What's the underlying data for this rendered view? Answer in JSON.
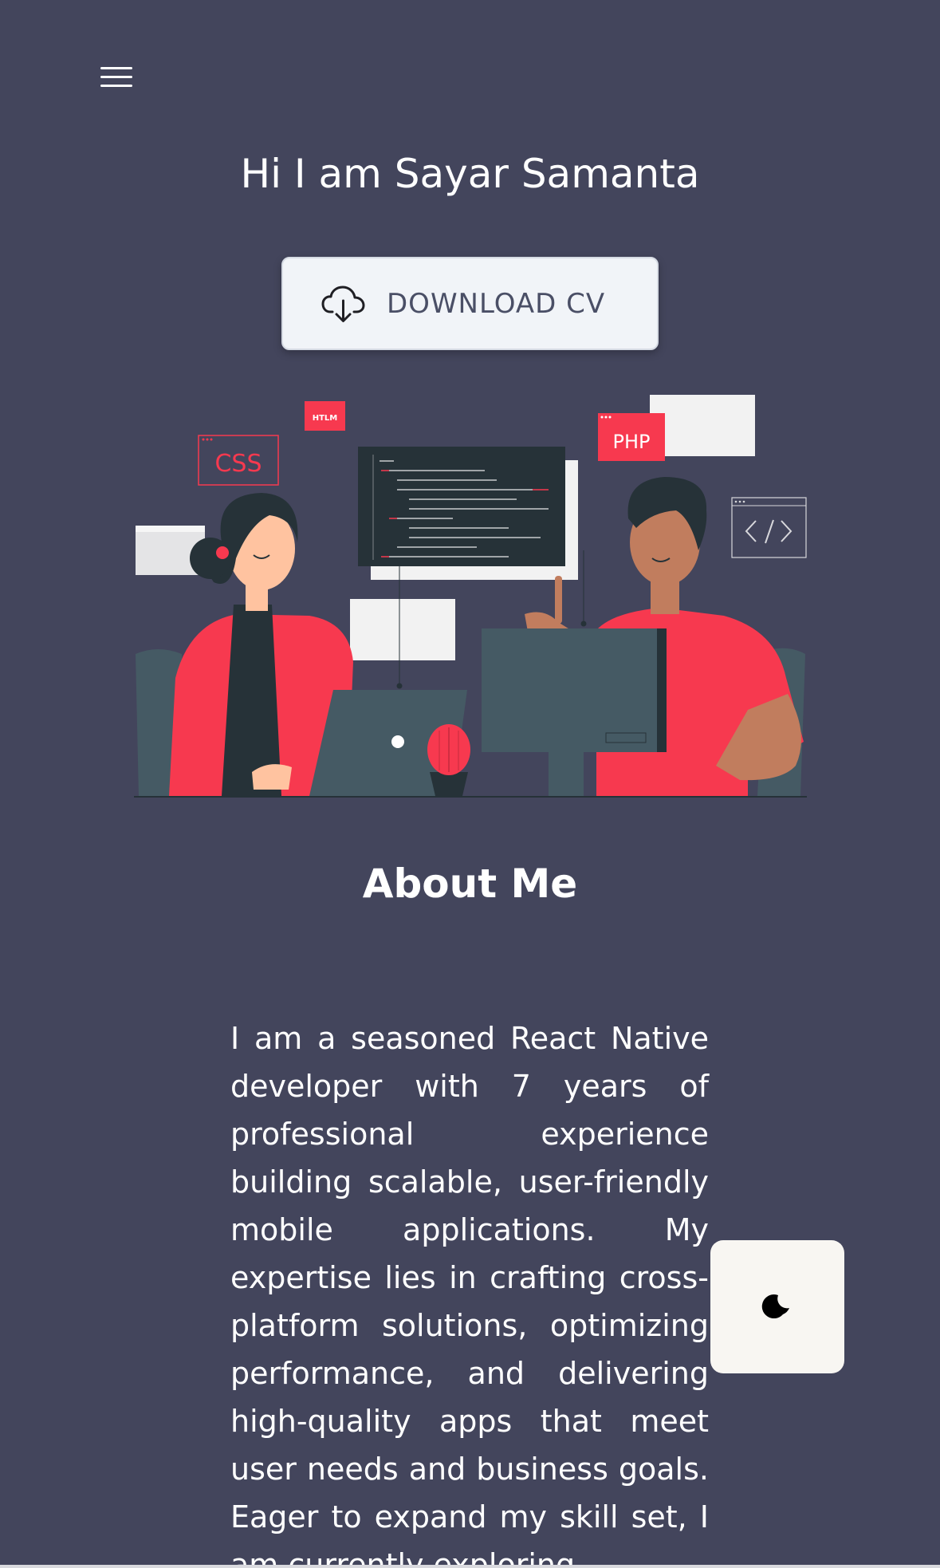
{
  "header": {
    "menu_icon": "hamburger-menu-icon"
  },
  "hero": {
    "title": "Hi I am Sayar Samanta",
    "download_button": {
      "label": "DOWNLOAD CV",
      "icon": "cloud-download-icon"
    }
  },
  "illustration": {
    "labels": {
      "css": "CSS",
      "htlm": "HTLM",
      "php": "PHP"
    }
  },
  "about": {
    "title": "About Me",
    "body": "I am a seasoned React Native developer with 7 years of professional experience building scalable, user-friendly mobile applications. My expertise lies in crafting cross-platform solutions, optimizing performance, and delivering high-quality apps that meet user needs and business goals. Eager to expand my skill set, I am currently exploring"
  },
  "theme_toggle": {
    "icon": "moon-icon"
  },
  "colors": {
    "background": "#43455c",
    "accent": "#f7394f",
    "dark": "#263238",
    "button_bg": "#f1f4f8"
  }
}
